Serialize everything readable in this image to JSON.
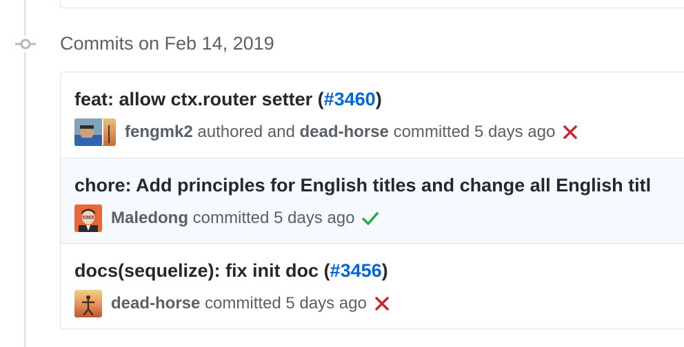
{
  "group": {
    "title": "Commits on Feb 14, 2019"
  },
  "commits": [
    {
      "title_prefix": "feat: allow ctx.router setter (",
      "pr_link": "#3460",
      "title_suffix": ")",
      "author": "fengmk2",
      "authored_text": "authored and",
      "committer": "dead-horse",
      "committed_text": "committed 5 days ago",
      "status": "failure",
      "status_icon": "x-icon",
      "avatars": [
        "avatar-fengmk2",
        "avatar-dead-horse"
      ]
    },
    {
      "title_prefix": "chore: Add principles for English titles and change all English titl",
      "author": "Maledong",
      "committed_text": "committed 5 days ago",
      "status": "success",
      "status_icon": "check-icon",
      "avatars": [
        "avatar-maledong"
      ]
    },
    {
      "title_prefix": "docs(sequelize): fix init doc (",
      "pr_link": "#3456",
      "title_suffix": ")",
      "author": "dead-horse",
      "committed_text": "committed 5 days ago",
      "status": "failure",
      "status_icon": "x-icon",
      "avatars": [
        "avatar-dead-horse"
      ]
    }
  ],
  "colors": {
    "link": "#0366d6",
    "failure": "#cb2431",
    "success": "#28a745",
    "muted": "#586069",
    "highlight_row": "#f6f9ff"
  }
}
